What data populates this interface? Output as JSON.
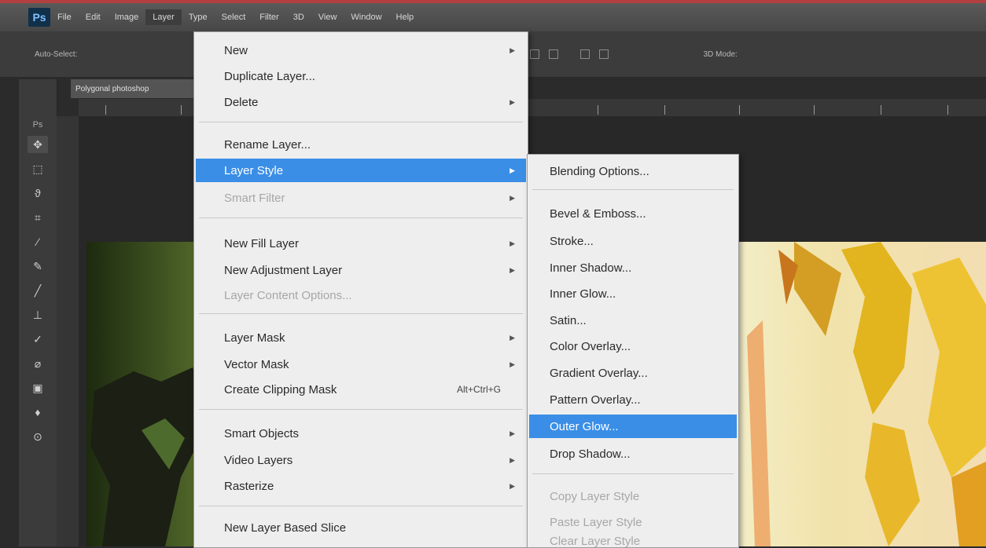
{
  "menubar": {
    "logo": "Ps",
    "items": [
      {
        "label": "File"
      },
      {
        "label": "Edit"
      },
      {
        "label": "Image"
      },
      {
        "label": "Layer"
      },
      {
        "label": "Type"
      },
      {
        "label": "Select"
      },
      {
        "label": "Filter"
      },
      {
        "label": "3D"
      },
      {
        "label": "View"
      },
      {
        "label": "Window"
      },
      {
        "label": "Help"
      }
    ]
  },
  "options_bar": {
    "auto_select": "Auto-Select:",
    "show_label": "3D Mode:"
  },
  "document": {
    "tab_label": "Polygonal photoshop"
  },
  "toolbar": {
    "panel_label": "Ps"
  },
  "layer_menu": {
    "new": "New",
    "duplicate": "Duplicate Layer...",
    "delete": "Delete",
    "rename": "Rename Layer...",
    "layer_style": "Layer Style",
    "smart_filter": "Smart Filter",
    "new_fill_layer": "New Fill Layer",
    "new_adjustment_layer": "New Adjustment Layer",
    "layer_content_options": "Layer Content Options...",
    "layer_mask": "Layer Mask",
    "vector_mask": "Vector Mask",
    "create_clipping_mask": "Create Clipping Mask",
    "create_clipping_mask_shortcut": "Alt+Ctrl+G",
    "smart_objects": "Smart Objects",
    "video_layers": "Video Layers",
    "rasterize": "Rasterize",
    "new_layer_based_slice": "New Layer Based Slice"
  },
  "layer_style_submenu": {
    "blending_options": "Blending Options...",
    "bevel_emboss": "Bevel & Emboss...",
    "stroke": "Stroke...",
    "inner_shadow": "Inner Shadow...",
    "inner_glow": "Inner Glow...",
    "satin": "Satin...",
    "color_overlay": "Color Overlay...",
    "gradient_overlay": "Gradient Overlay...",
    "pattern_overlay": "Pattern Overlay...",
    "outer_glow": "Outer Glow...",
    "drop_shadow": "Drop Shadow...",
    "copy_layer_style": "Copy Layer Style",
    "paste_layer_style": "Paste Layer Style",
    "clear_layer_style": "Clear Layer Style"
  },
  "colors": {
    "highlight": "#3a8ee6",
    "menu_bg": "#eeeeee",
    "app_bg": "#2b2b2b"
  }
}
